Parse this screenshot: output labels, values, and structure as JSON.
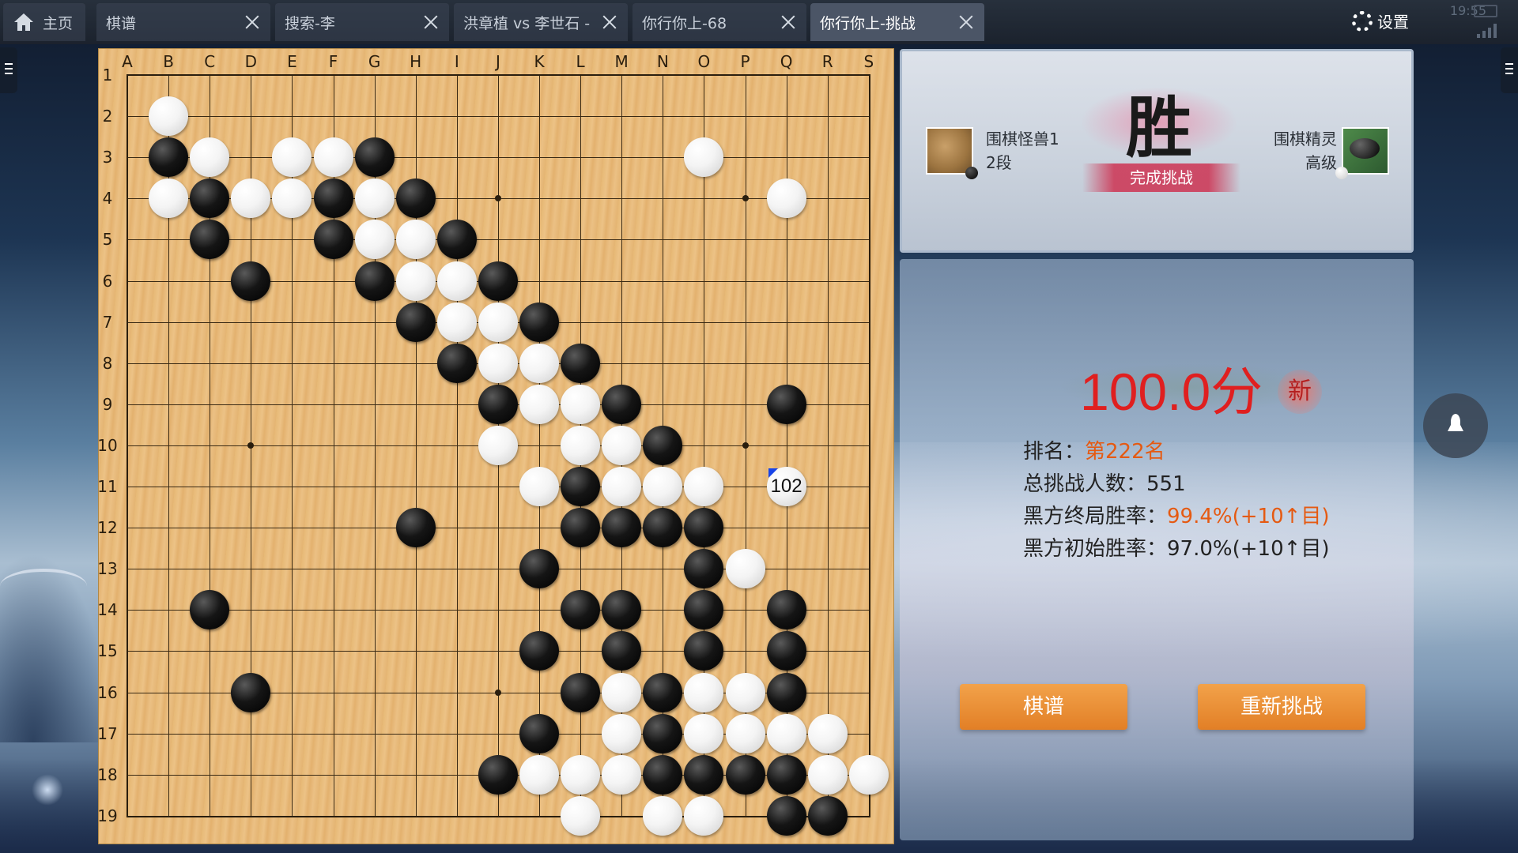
{
  "tabs": [
    {
      "label": "主页",
      "icon": "home-icon",
      "closable": false
    },
    {
      "label": "棋谱",
      "closable": true
    },
    {
      "label": "搜索-李",
      "closable": true
    },
    {
      "label": "洪章植 vs 李世石 -",
      "closable": true
    },
    {
      "label": "你行你上-68",
      "closable": true
    },
    {
      "label": "你行你上-挑战",
      "closable": true,
      "active": true
    }
  ],
  "settings_label": "设置",
  "status_time": "19:55",
  "board": {
    "columns": [
      "A",
      "B",
      "C",
      "D",
      "E",
      "F",
      "G",
      "H",
      "I",
      "J",
      "K",
      "L",
      "M",
      "N",
      "O",
      "P",
      "Q",
      "R",
      "S"
    ],
    "rows": [
      "1",
      "2",
      "3",
      "4",
      "5",
      "6",
      "7",
      "8",
      "9",
      "10",
      "11",
      "12",
      "13",
      "14",
      "15",
      "16",
      "17",
      "18",
      "19"
    ],
    "black_stones": [
      "B3",
      "C4",
      "F4",
      "G3",
      "H4",
      "C5",
      "F5",
      "I5",
      "D6",
      "G6",
      "J6",
      "H7",
      "K7",
      "I8",
      "L8",
      "J9",
      "M9",
      "Q9",
      "N10",
      "L11",
      "H12",
      "L12",
      "M12",
      "N12",
      "O12",
      "K13",
      "O13",
      "C14",
      "L14",
      "M14",
      "O14",
      "Q14",
      "K15",
      "M15",
      "O15",
      "Q15",
      "D16",
      "L16",
      "N16",
      "Q16",
      "K17",
      "N17",
      "J18",
      "N18",
      "O18",
      "P18",
      "Q18",
      "Q19",
      "R19"
    ],
    "white_stones": [
      "B2",
      "C3",
      "E3",
      "F3",
      "O3",
      "B4",
      "D4",
      "E4",
      "G4",
      "Q4",
      "G5",
      "H5",
      "H6",
      "I6",
      "I7",
      "J7",
      "J8",
      "K8",
      "K9",
      "L9",
      "J10",
      "L10",
      "M10",
      "K11",
      "M11",
      "N11",
      "O11",
      "P13",
      "M16",
      "O16",
      "P16",
      "M17",
      "O17",
      "P17",
      "Q17",
      "R17",
      "K18",
      "L18",
      "M18",
      "R18",
      "S18",
      "L19",
      "N19",
      "O19"
    ],
    "last_move": {
      "point": "Q11",
      "color": "white",
      "number": "102"
    }
  },
  "result": {
    "left_player": {
      "name": "围棋怪兽1",
      "rank": "2段",
      "color": "black"
    },
    "right_player": {
      "name": "围棋精灵",
      "rank": "高级",
      "color": "white"
    },
    "win_char": "胜",
    "banner": "完成挑战"
  },
  "stats": {
    "score": "100.0分",
    "new_badge": "新",
    "rank_label": "排名：",
    "rank_value": "第222名",
    "total_label": "总挑战人数：",
    "total_value": "551",
    "final_rate_label": "黑方终局胜率：",
    "final_rate_value": "99.4%(+10↑目)",
    "initial_rate_label": "黑方初始胜率：",
    "initial_rate_value": "97.0%(+10↑目)"
  },
  "buttons": {
    "record": "棋谱",
    "retry": "重新挑战"
  },
  "colors": {
    "accent_orange": "#e27f26",
    "score_red": "#e01f1f",
    "highlight_orange": "#e55a12"
  }
}
